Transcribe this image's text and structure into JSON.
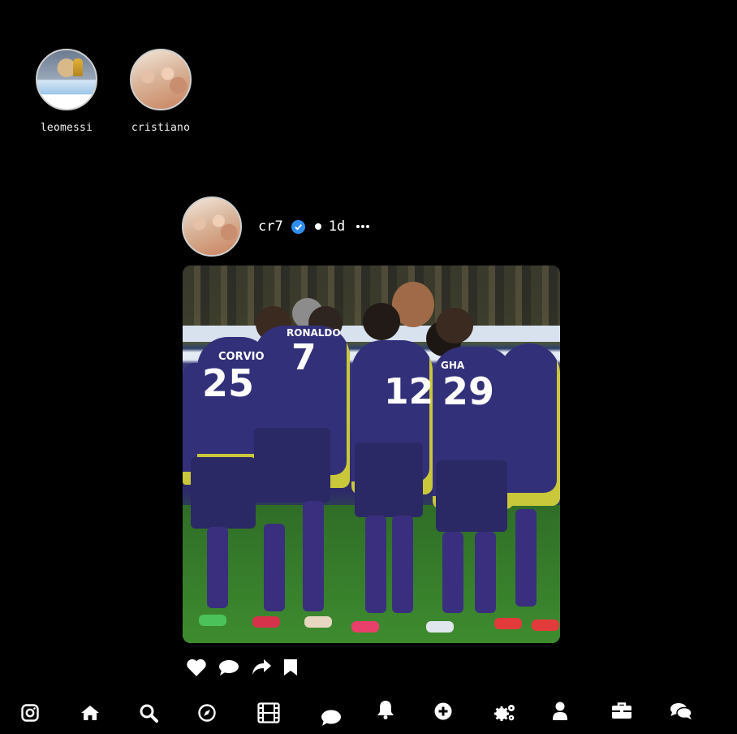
{
  "stories": [
    {
      "username": "leomessi",
      "avatar_icon": "profile-photo"
    },
    {
      "username": "cristiano",
      "avatar_icon": "profile-photo"
    }
  ],
  "post": {
    "username": "cr7",
    "verified_icon": "verified-check-icon",
    "separator": "•",
    "time": "1d",
    "more_icon": "ellipsis-icon",
    "jersey_numbers": [
      "25",
      "7",
      "12",
      "29"
    ],
    "jersey_names": [
      "CORVIO",
      "RONALDO",
      "GHA"
    ]
  },
  "actions": [
    "heart-icon",
    "comment-icon",
    "share-icon",
    "bookmark-icon"
  ],
  "nav": [
    "instagram-icon",
    "home-icon",
    "search-icon",
    "compass-icon",
    "reels-icon",
    "messages-icon",
    "bell-icon",
    "plus-icon",
    "settings-icon",
    "user-icon",
    "briefcase-icon",
    "chat-icon"
  ],
  "colors": {
    "background": "#000000",
    "verified": "#2e8ef0",
    "text": "#ffffff"
  }
}
